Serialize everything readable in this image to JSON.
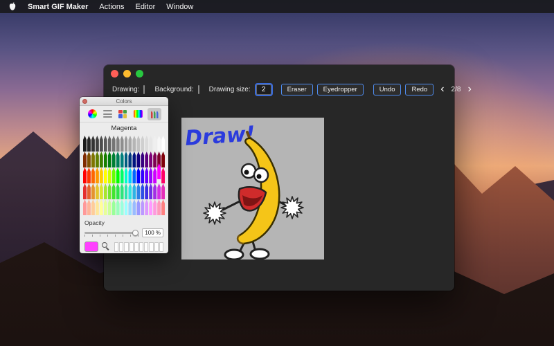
{
  "menu_bar": {
    "app_name": "Smart GIF Maker",
    "items": [
      "Actions",
      "Editor",
      "Window"
    ]
  },
  "editor_window": {
    "traffic_lights": {
      "close": "#ff5f57",
      "minimize": "#febc2e",
      "zoom": "#28c840"
    },
    "toolbar": {
      "drawing_label": "Drawing:",
      "drawing_color": "#ff3bf4",
      "background_label": "Background:",
      "background_color": "#a9a9a9",
      "drawing_size_label": "Drawing size:",
      "drawing_size_value": "2",
      "eraser_label": "Eraser",
      "eyedropper_label": "Eyedropper",
      "undo_label": "Undo",
      "redo_label": "Redo",
      "prev_icon": "‹",
      "next_icon": "›",
      "page_indicator": "2/8"
    },
    "canvas": {
      "background_color": "#b5b5b5",
      "annotation": "Draw!",
      "annotation_color": "#2b3bdd"
    }
  },
  "colors_panel": {
    "window_title": "Colors",
    "selected_color_name": "Magenta",
    "opacity_label": "Opacity",
    "opacity_value": "100 %",
    "current_color": "#ff40ff",
    "selected_pencil": {
      "row": 2,
      "index": 18
    },
    "pencil_rows": [
      [
        "#1a1a1a",
        "#262626",
        "#333333",
        "#404040",
        "#4d4d4d",
        "#5a5a5a",
        "#676767",
        "#747474",
        "#818181",
        "#8e8e8e",
        "#9b9b9b",
        "#a8a8a8",
        "#b5b5b5",
        "#c2c2c2",
        "#cfcfcf",
        "#dcdcdc",
        "#e6e6e6",
        "#efefef",
        "#f7f7f7",
        "#ffffff"
      ],
      [
        "#7f2a00",
        "#7f4f00",
        "#7f7400",
        "#617f00",
        "#3c7f00",
        "#177f00",
        "#007f0e",
        "#007f33",
        "#007f58",
        "#007f7d",
        "#005d7f",
        "#00387f",
        "#00137f",
        "#12007f",
        "#37007f",
        "#5c007f",
        "#7f0078",
        "#7f0053",
        "#7f002e",
        "#7f0009"
      ],
      [
        "#ff0000",
        "#ff3300",
        "#ff6600",
        "#ff9900",
        "#ffcc00",
        "#ffff00",
        "#ccff00",
        "#66ff00",
        "#00ff00",
        "#00ff66",
        "#00ffcc",
        "#00ccff",
        "#0066ff",
        "#0000ff",
        "#3300ff",
        "#6600ff",
        "#9900ff",
        "#cc00ff",
        "#ff00ff",
        "#ff0066"
      ],
      [
        "#e52e2e",
        "#e5602e",
        "#e5932e",
        "#e5c52e",
        "#d9e52e",
        "#a6e52e",
        "#74e52e",
        "#41e52e",
        "#2ee54a",
        "#2ee57c",
        "#2ee5af",
        "#2ee5e2",
        "#2eb3e5",
        "#2e80e5",
        "#2e4ee5",
        "#3d2ee5",
        "#702ee5",
        "#a22ee5",
        "#d52ee5",
        "#e52eb8"
      ],
      [
        "#ff9999",
        "#ffb399",
        "#ffcc99",
        "#ffe699",
        "#ffff99",
        "#e6ff99",
        "#ccff99",
        "#99ff99",
        "#99ffbb",
        "#99ffdd",
        "#99ffff",
        "#99ddff",
        "#99bbff",
        "#9999ff",
        "#bb99ff",
        "#dd99ff",
        "#ff99ff",
        "#ff99dd",
        "#ff99bb",
        "#ff8080"
      ]
    ]
  }
}
